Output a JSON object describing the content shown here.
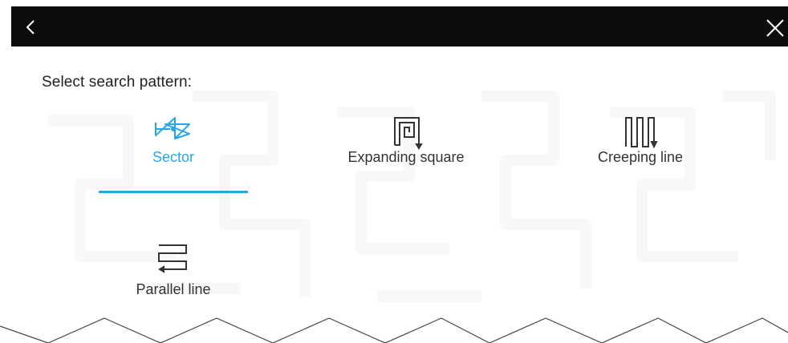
{
  "header": {
    "back_icon": "chevron-left-icon",
    "close_icon": "close-icon"
  },
  "heading": "Select search pattern:",
  "patterns": [
    {
      "label": "Sector",
      "icon": "sector-pattern-icon",
      "selected": true
    },
    {
      "label": "Expanding square",
      "icon": "expanding-square-icon",
      "selected": false
    },
    {
      "label": "Creeping line",
      "icon": "creeping-line-icon",
      "selected": false
    },
    {
      "label": "Parallel line",
      "icon": "parallel-line-icon",
      "selected": false
    }
  ],
  "colors": {
    "accent": "#2aa5e6",
    "topbar": "#0d0d0d",
    "text": "#333333"
  }
}
